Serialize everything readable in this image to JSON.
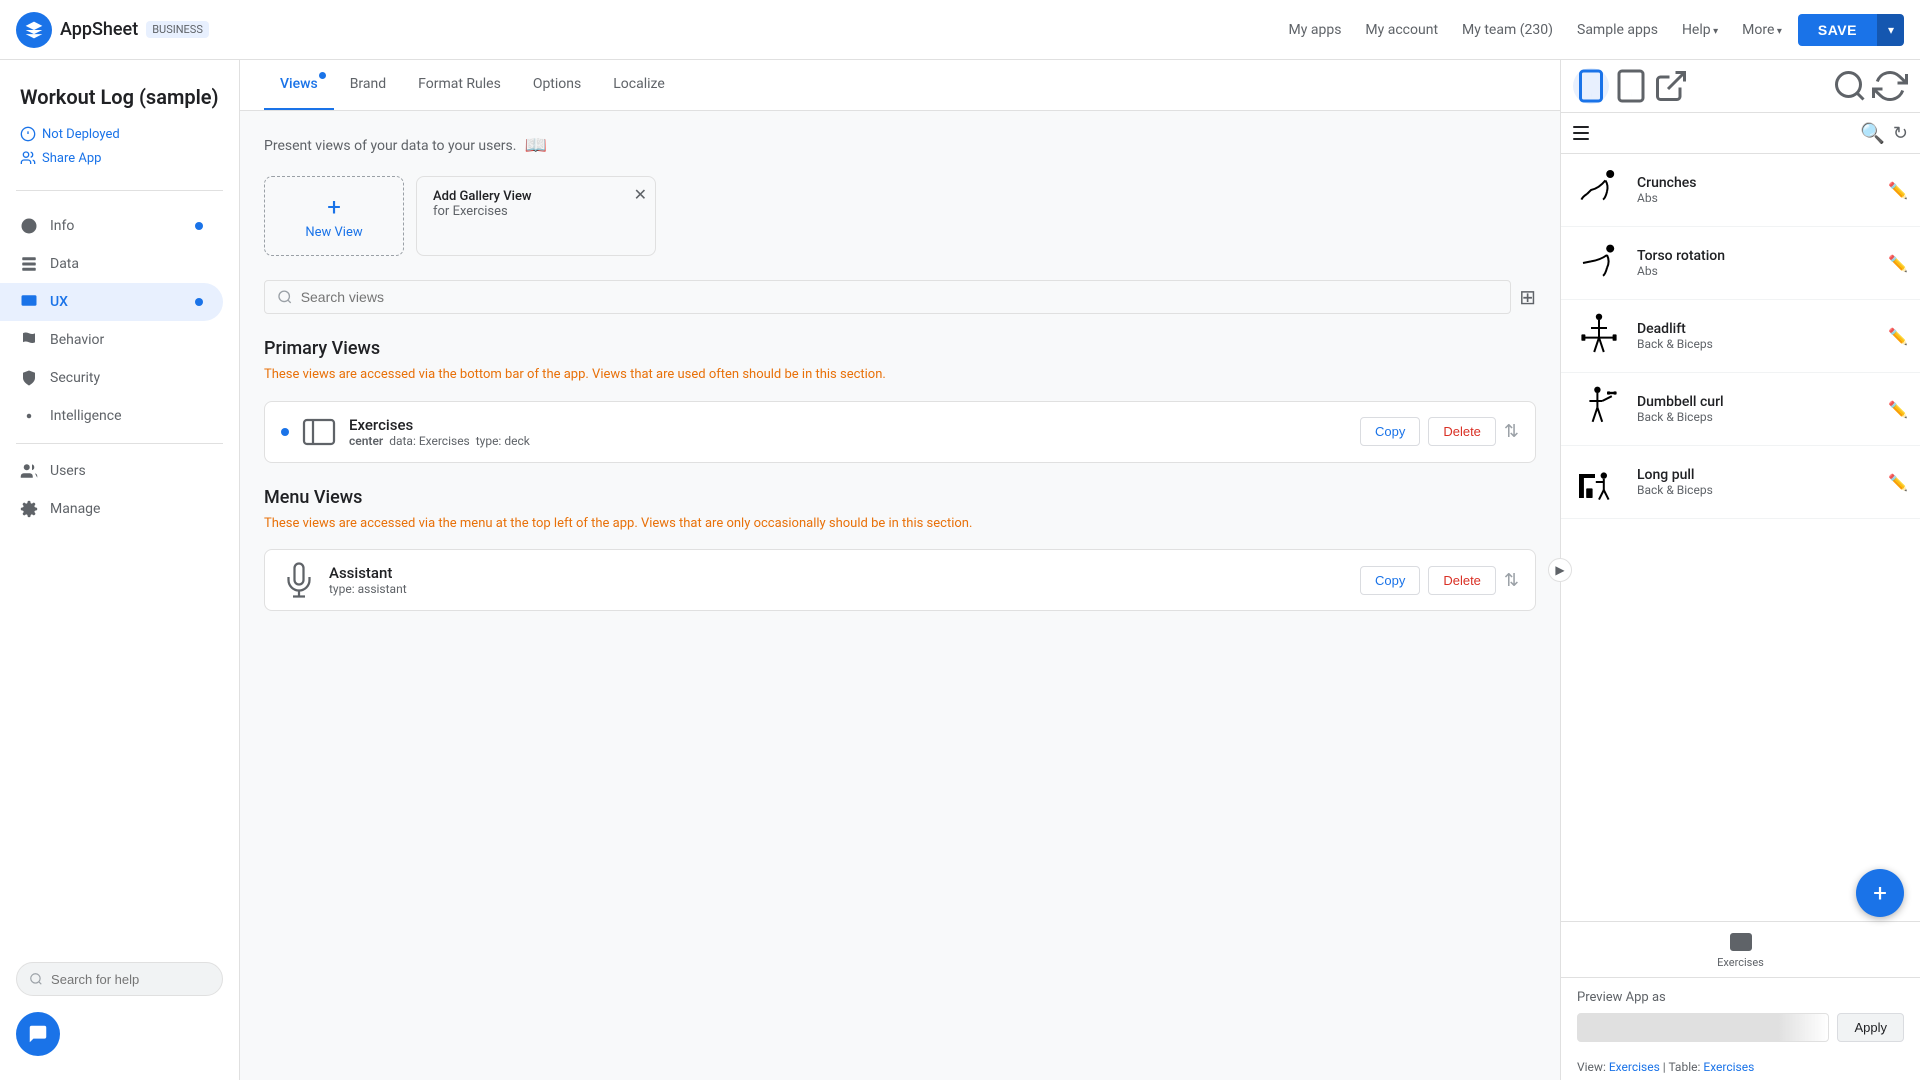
{
  "topNav": {
    "logoText": "AppSheet",
    "logoBadge": "BUSINESS",
    "links": [
      "My apps",
      "My account",
      "My team (230)",
      "Sample apps",
      "Help",
      "More"
    ],
    "hasArrow": [
      false,
      false,
      false,
      false,
      true,
      true
    ],
    "saveLabel": "SAVE"
  },
  "sidebar": {
    "appTitle": "Workout Log (sample)",
    "notDeployed": "Not Deployed",
    "shareApp": "Share App",
    "navItems": [
      {
        "label": "Info",
        "hasDot": true
      },
      {
        "label": "Data",
        "hasDot": false
      },
      {
        "label": "UX",
        "hasDot": true,
        "active": true
      },
      {
        "label": "Behavior",
        "hasDot": false
      },
      {
        "label": "Security",
        "hasDot": false
      },
      {
        "label": "Intelligence",
        "hasDot": false
      },
      {
        "label": "Users",
        "hasDot": false
      },
      {
        "label": "Manage",
        "hasDot": false
      }
    ],
    "searchPlaceholder": "Search for help"
  },
  "tabs": [
    {
      "label": "Views",
      "hasDot": true,
      "active": true
    },
    {
      "label": "Brand",
      "hasDot": false
    },
    {
      "label": "Format Rules",
      "hasDot": false
    },
    {
      "label": "Options",
      "hasDot": false
    },
    {
      "label": "Localize",
      "hasDot": false
    }
  ],
  "mainContent": {
    "description": "Present views of your data to your users.",
    "newViewLabel": "New View",
    "galleryCard": {
      "title": "Add Gallery View",
      "subtitle": "for Exercises"
    },
    "searchPlaceholder": "Search views",
    "primaryViews": {
      "heading": "Primary Views",
      "warning": "These views are accessed via the bottom bar of the app. Views that are used often should be in this section.",
      "items": [
        {
          "name": "Exercises",
          "center": "center",
          "data": "Exercises",
          "type": "deck",
          "hasDot": true
        }
      ]
    },
    "menuViews": {
      "heading": "Menu Views",
      "warning": "These views are accessed via the menu at the top left of the app. Views that are only occasionally should be in this section.",
      "items": [
        {
          "name": "Assistant",
          "type": "assistant",
          "hasDot": false
        }
      ]
    },
    "copyLabel": "Copy",
    "deleteLabel": "Delete"
  },
  "previewPanel": {
    "deviceButtons": [
      "mobile",
      "tablet",
      "external"
    ],
    "exercises": [
      {
        "name": "Crunches",
        "category": "Abs"
      },
      {
        "name": "Torso rotation",
        "category": "Abs"
      },
      {
        "name": "Deadlift",
        "category": "Back & Biceps"
      },
      {
        "name": "Dumbbell curl",
        "category": "Back & Biceps"
      },
      {
        "name": "Long pull",
        "category": "Back & Biceps"
      }
    ],
    "bottomNavLabel": "Exercises",
    "previewAppAs": "Preview App as",
    "applyLabel": "Apply",
    "viewLabel": "View:",
    "viewLink": "Exercises",
    "tableLabel": "Table:",
    "tableLink": "Exercises"
  }
}
